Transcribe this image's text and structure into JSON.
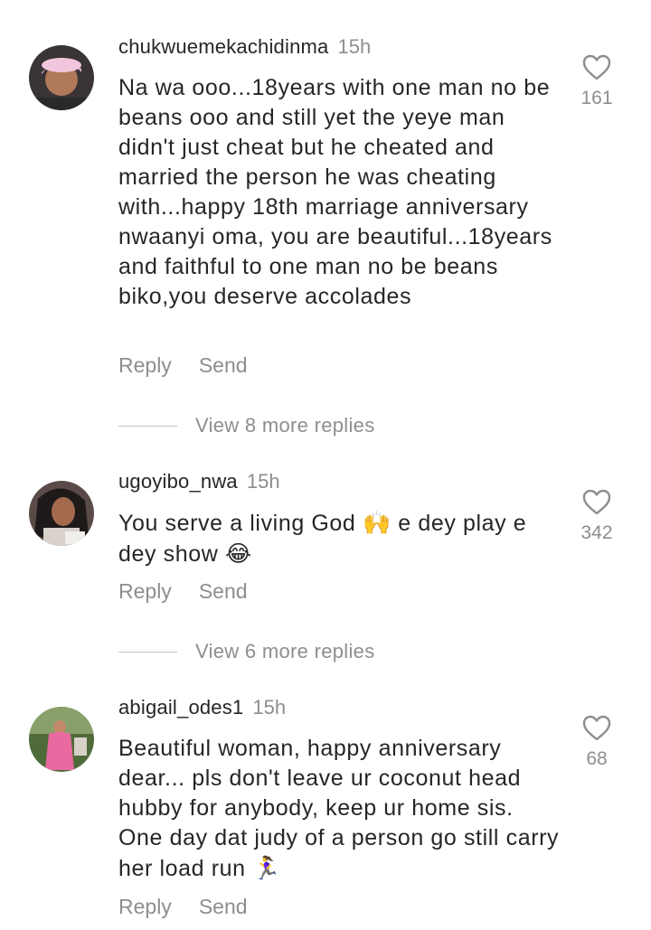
{
  "comments": [
    {
      "username": "chukwuemekachidinma",
      "time": "15h",
      "text": "Na wa ooo...18years with one man no be beans ooo and still yet the yeye man didn't just cheat but he cheated and married the person he was cheating with...happy 18th marriage anniversary nwaanyi oma, you are beautiful...18years and faithful to one man no be beans biko,you deserve accolades",
      "likes": "161",
      "reply_label": "Reply",
      "send_label": "Send",
      "view_replies": "View 8 more replies",
      "avatar_icon": "avatar-photo"
    },
    {
      "username": "ugoyibo_nwa",
      "time": "15h",
      "text_parts": [
        "You serve a living God ",
        "🙌",
        " e dey play e dey show ",
        "😂"
      ],
      "likes": "342",
      "reply_label": "Reply",
      "send_label": "Send",
      "view_replies": "View 6 more replies",
      "avatar_icon": "avatar-photo"
    },
    {
      "username": "abigail_odes1",
      "time": "15h",
      "text_parts": [
        "Beautiful woman, happy anniversary dear... pls don't leave ur coconut head hubby for anybody, keep ur home sis. One day dat judy of a person go still carry her load run ",
        "🏃‍♀️"
      ],
      "likes": "68",
      "reply_label": "Reply",
      "send_label": "Send",
      "avatar_icon": "avatar-photo"
    }
  ],
  "icons": {
    "like": "heart-outline-icon"
  },
  "colors": {
    "text": "#262626",
    "secondary": "#8e8e8e",
    "rule": "#c7c7c7"
  }
}
